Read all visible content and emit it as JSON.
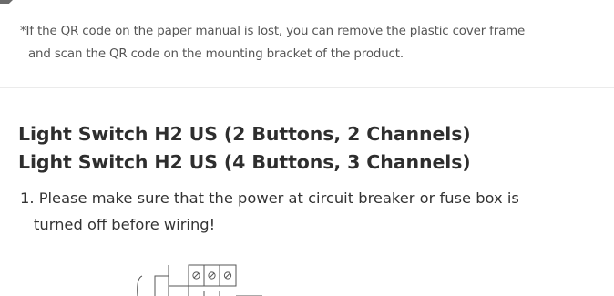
{
  "note": {
    "line1": "*If the QR code on the paper manual is lost, you can remove the plastic cover frame",
    "line2": "and scan the QR code on the mounting bracket of the product."
  },
  "section": {
    "title_line1": "Light Switch H2 US (2 Buttons, 2 Channels)",
    "title_line2": "Light Switch H2 US (4 Buttons, 3 Channels)"
  },
  "steps": [
    {
      "line1": "1. Please make sure that the power at circuit breaker or fuse box is",
      "line2": "turned off before wiring!"
    }
  ],
  "diagram": {
    "icon": "wiring-terminal-diagram"
  }
}
